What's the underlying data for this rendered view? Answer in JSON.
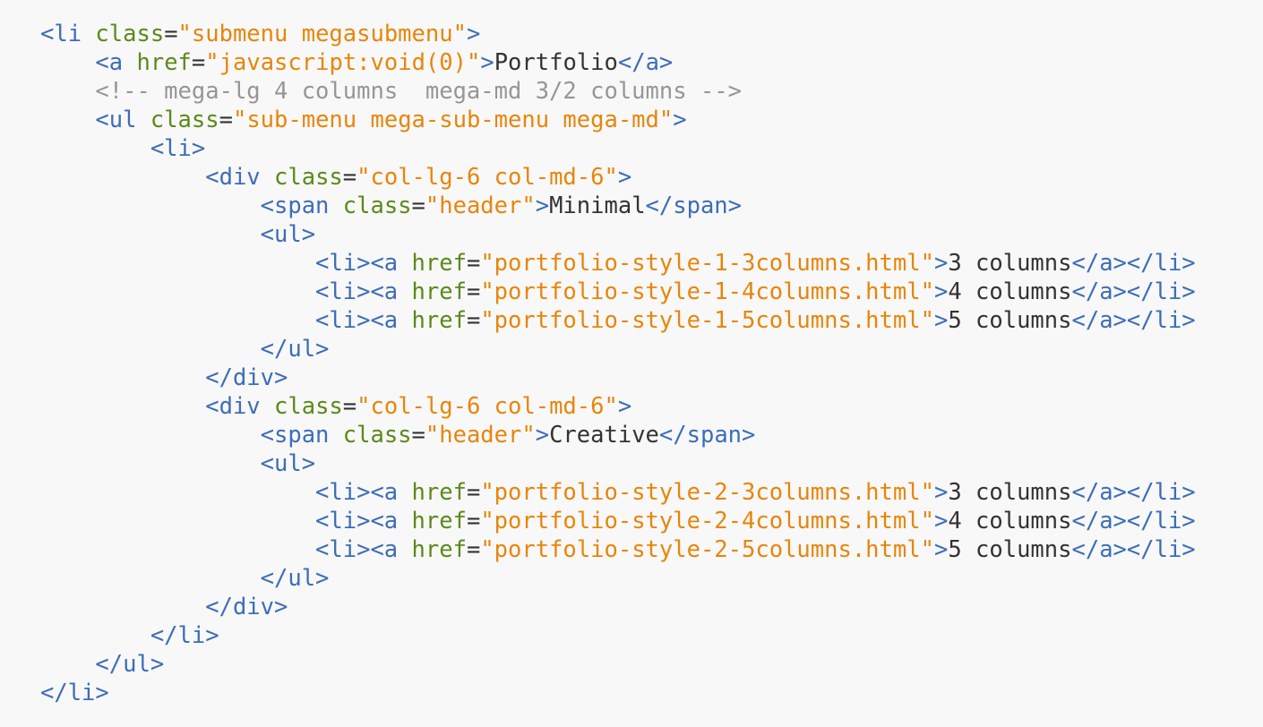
{
  "colors": {
    "background": "#f8f8f8",
    "tag": "#3c6db8",
    "attribute": "#5b8a1a",
    "punctuation": "#333333",
    "string": "#e8850a",
    "text": "#333333",
    "comment": "#969696"
  },
  "code": {
    "lines": [
      {
        "indent": 0,
        "tokens": [
          {
            "t": "tag",
            "v": "<li"
          },
          {
            "t": "punct",
            "v": " "
          },
          {
            "t": "attr",
            "v": "class"
          },
          {
            "t": "punct",
            "v": "="
          },
          {
            "t": "str",
            "v": "\"submenu megasubmenu\""
          },
          {
            "t": "tag",
            "v": ">"
          }
        ]
      },
      {
        "indent": 1,
        "tokens": [
          {
            "t": "tag",
            "v": "<a"
          },
          {
            "t": "punct",
            "v": " "
          },
          {
            "t": "attr",
            "v": "href"
          },
          {
            "t": "punct",
            "v": "="
          },
          {
            "t": "str",
            "v": "\"javascript:void(0)\""
          },
          {
            "t": "tag",
            "v": ">"
          },
          {
            "t": "text",
            "v": "Portfolio"
          },
          {
            "t": "tag",
            "v": "</a>"
          }
        ]
      },
      {
        "indent": 1,
        "tokens": [
          {
            "t": "comment",
            "v": "<!-- mega-lg 4 columns  mega-md 3/2 columns -->"
          }
        ]
      },
      {
        "indent": 1,
        "tokens": [
          {
            "t": "tag",
            "v": "<ul"
          },
          {
            "t": "punct",
            "v": " "
          },
          {
            "t": "attr",
            "v": "class"
          },
          {
            "t": "punct",
            "v": "="
          },
          {
            "t": "str",
            "v": "\"sub-menu mega-sub-menu mega-md\""
          },
          {
            "t": "tag",
            "v": ">"
          }
        ]
      },
      {
        "indent": 2,
        "tokens": [
          {
            "t": "tag",
            "v": "<li>"
          }
        ]
      },
      {
        "indent": 3,
        "tokens": [
          {
            "t": "tag",
            "v": "<div"
          },
          {
            "t": "punct",
            "v": " "
          },
          {
            "t": "attr",
            "v": "class"
          },
          {
            "t": "punct",
            "v": "="
          },
          {
            "t": "str",
            "v": "\"col-lg-6 col-md-6\""
          },
          {
            "t": "tag",
            "v": ">"
          }
        ]
      },
      {
        "indent": 4,
        "tokens": [
          {
            "t": "tag",
            "v": "<span"
          },
          {
            "t": "punct",
            "v": " "
          },
          {
            "t": "attr",
            "v": "class"
          },
          {
            "t": "punct",
            "v": "="
          },
          {
            "t": "str",
            "v": "\"header\""
          },
          {
            "t": "tag",
            "v": ">"
          },
          {
            "t": "text",
            "v": "Minimal"
          },
          {
            "t": "tag",
            "v": "</span>"
          }
        ]
      },
      {
        "indent": 4,
        "tokens": [
          {
            "t": "tag",
            "v": "<ul>"
          }
        ]
      },
      {
        "indent": 5,
        "tokens": [
          {
            "t": "tag",
            "v": "<li><a"
          },
          {
            "t": "punct",
            "v": " "
          },
          {
            "t": "attr",
            "v": "href"
          },
          {
            "t": "punct",
            "v": "="
          },
          {
            "t": "str",
            "v": "\"portfolio-style-1-3columns.html\""
          },
          {
            "t": "tag",
            "v": ">"
          },
          {
            "t": "text",
            "v": "3 columns"
          },
          {
            "t": "tag",
            "v": "</a></li>"
          }
        ]
      },
      {
        "indent": 5,
        "tokens": [
          {
            "t": "tag",
            "v": "<li><a"
          },
          {
            "t": "punct",
            "v": " "
          },
          {
            "t": "attr",
            "v": "href"
          },
          {
            "t": "punct",
            "v": "="
          },
          {
            "t": "str",
            "v": "\"portfolio-style-1-4columns.html\""
          },
          {
            "t": "tag",
            "v": ">"
          },
          {
            "t": "text",
            "v": "4 columns"
          },
          {
            "t": "tag",
            "v": "</a></li>"
          }
        ]
      },
      {
        "indent": 5,
        "tokens": [
          {
            "t": "tag",
            "v": "<li><a"
          },
          {
            "t": "punct",
            "v": " "
          },
          {
            "t": "attr",
            "v": "href"
          },
          {
            "t": "punct",
            "v": "="
          },
          {
            "t": "str",
            "v": "\"portfolio-style-1-5columns.html\""
          },
          {
            "t": "tag",
            "v": ">"
          },
          {
            "t": "text",
            "v": "5 columns"
          },
          {
            "t": "tag",
            "v": "</a></li>"
          }
        ]
      },
      {
        "indent": 4,
        "tokens": [
          {
            "t": "tag",
            "v": "</ul>"
          }
        ]
      },
      {
        "indent": 3,
        "tokens": [
          {
            "t": "tag",
            "v": "</div>"
          }
        ]
      },
      {
        "indent": 3,
        "tokens": [
          {
            "t": "tag",
            "v": "<div"
          },
          {
            "t": "punct",
            "v": " "
          },
          {
            "t": "attr",
            "v": "class"
          },
          {
            "t": "punct",
            "v": "="
          },
          {
            "t": "str",
            "v": "\"col-lg-6 col-md-6\""
          },
          {
            "t": "tag",
            "v": ">"
          }
        ]
      },
      {
        "indent": 4,
        "tokens": [
          {
            "t": "tag",
            "v": "<span"
          },
          {
            "t": "punct",
            "v": " "
          },
          {
            "t": "attr",
            "v": "class"
          },
          {
            "t": "punct",
            "v": "="
          },
          {
            "t": "str",
            "v": "\"header\""
          },
          {
            "t": "tag",
            "v": ">"
          },
          {
            "t": "text",
            "v": "Creative"
          },
          {
            "t": "tag",
            "v": "</span>"
          }
        ]
      },
      {
        "indent": 4,
        "tokens": [
          {
            "t": "tag",
            "v": "<ul>"
          }
        ]
      },
      {
        "indent": 5,
        "tokens": [
          {
            "t": "tag",
            "v": "<li><a"
          },
          {
            "t": "punct",
            "v": " "
          },
          {
            "t": "attr",
            "v": "href"
          },
          {
            "t": "punct",
            "v": "="
          },
          {
            "t": "str",
            "v": "\"portfolio-style-2-3columns.html\""
          },
          {
            "t": "tag",
            "v": ">"
          },
          {
            "t": "text",
            "v": "3 columns"
          },
          {
            "t": "tag",
            "v": "</a></li>"
          }
        ]
      },
      {
        "indent": 5,
        "tokens": [
          {
            "t": "tag",
            "v": "<li><a"
          },
          {
            "t": "punct",
            "v": " "
          },
          {
            "t": "attr",
            "v": "href"
          },
          {
            "t": "punct",
            "v": "="
          },
          {
            "t": "str",
            "v": "\"portfolio-style-2-4columns.html\""
          },
          {
            "t": "tag",
            "v": ">"
          },
          {
            "t": "text",
            "v": "4 columns"
          },
          {
            "t": "tag",
            "v": "</a></li>"
          }
        ]
      },
      {
        "indent": 5,
        "tokens": [
          {
            "t": "tag",
            "v": "<li><a"
          },
          {
            "t": "punct",
            "v": " "
          },
          {
            "t": "attr",
            "v": "href"
          },
          {
            "t": "punct",
            "v": "="
          },
          {
            "t": "str",
            "v": "\"portfolio-style-2-5columns.html\""
          },
          {
            "t": "tag",
            "v": ">"
          },
          {
            "t": "text",
            "v": "5 columns"
          },
          {
            "t": "tag",
            "v": "</a></li>"
          }
        ]
      },
      {
        "indent": 4,
        "tokens": [
          {
            "t": "tag",
            "v": "</ul>"
          }
        ]
      },
      {
        "indent": 3,
        "tokens": [
          {
            "t": "tag",
            "v": "</div>"
          }
        ]
      },
      {
        "indent": 2,
        "tokens": [
          {
            "t": "tag",
            "v": "</li>"
          }
        ]
      },
      {
        "indent": 1,
        "tokens": [
          {
            "t": "tag",
            "v": "</ul>"
          }
        ]
      },
      {
        "indent": 0,
        "tokens": [
          {
            "t": "tag",
            "v": "</li>"
          }
        ]
      }
    ]
  }
}
